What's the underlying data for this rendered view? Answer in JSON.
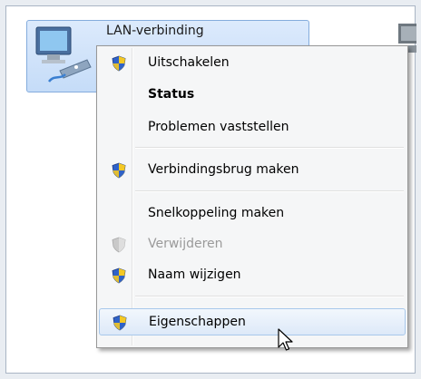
{
  "connection": {
    "name": "LAN-verbinding"
  },
  "menu": {
    "items": [
      {
        "label": "Uitschakelen",
        "shield": true,
        "bold": false,
        "disabled": false
      },
      {
        "label": "Status",
        "shield": false,
        "bold": true,
        "disabled": false
      },
      {
        "label": "Problemen vaststellen",
        "shield": false,
        "bold": false,
        "disabled": false
      },
      {
        "label": "Verbindingsbrug maken",
        "shield": true,
        "bold": false,
        "disabled": false
      },
      {
        "label": "Snelkoppeling maken",
        "shield": false,
        "bold": false,
        "disabled": false
      },
      {
        "label": "Verwijderen",
        "shield": true,
        "bold": false,
        "disabled": true
      },
      {
        "label": "Naam wijzigen",
        "shield": true,
        "bold": false,
        "disabled": false
      },
      {
        "label": "Eigenschappen",
        "shield": true,
        "bold": false,
        "disabled": false,
        "highlighted": true
      }
    ]
  },
  "colors": {
    "highlight_border": "#a8c8eb",
    "selection_bg": "#c5dcf8",
    "shield_blue": "#2f62c8",
    "shield_yellow": "#f4c824"
  }
}
